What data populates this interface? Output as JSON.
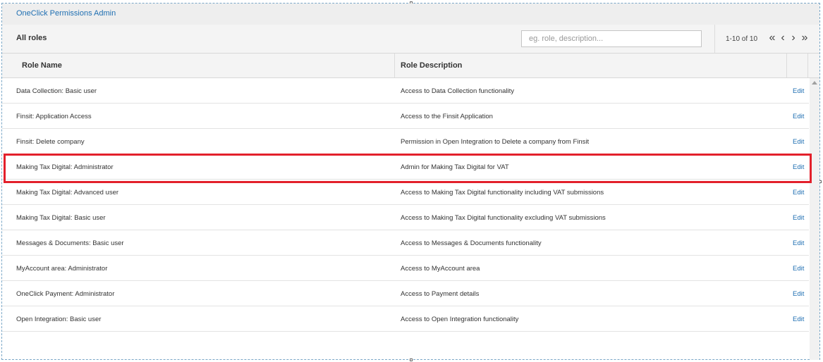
{
  "app": {
    "title": "OneClick Permissions Admin"
  },
  "toolbar": {
    "heading": "All roles",
    "search_placeholder": "eg. role, description...",
    "search_value": "",
    "page_info": "1-10 of 10",
    "nav": {
      "first": "«",
      "prev": "‹",
      "next": "›",
      "last": "»"
    }
  },
  "table": {
    "columns": [
      "Role Name",
      "Role Description"
    ],
    "rows": [
      {
        "name": "Data Collection: Basic user",
        "description": "Access to Data Collection functionality",
        "action": "Edit"
      },
      {
        "name": "Finsit: Application Access",
        "description": "Access to the Finsit Application",
        "action": "Edit"
      },
      {
        "name": "Finsit: Delete company",
        "description": "Permission in Open Integration to Delete a company from Finsit",
        "action": "Edit"
      },
      {
        "name": "Making Tax Digital: Administrator",
        "description": "Admin for Making Tax Digital for VAT",
        "action": "Edit"
      },
      {
        "name": "Making Tax Digital: Advanced user",
        "description": "Access to Making Tax Digital functionality including VAT submissions",
        "action": "Edit"
      },
      {
        "name": "Making Tax Digital: Basic user",
        "description": "Access to Making Tax Digital functionality excluding VAT submissions",
        "action": "Edit"
      },
      {
        "name": "Messages & Documents: Basic user",
        "description": "Access to Messages & Documents functionality",
        "action": "Edit"
      },
      {
        "name": "MyAccount area: Administrator",
        "description": "Access to MyAccount area",
        "action": "Edit"
      },
      {
        "name": "OneClick Payment: Administrator",
        "description": "Access to Payment details",
        "action": "Edit"
      },
      {
        "name": "Open Integration: Basic user",
        "description": "Access to Open Integration functionality",
        "action": "Edit"
      }
    ]
  },
  "colors": {
    "link": "#1f6fb2",
    "highlight": "#e3202b"
  }
}
